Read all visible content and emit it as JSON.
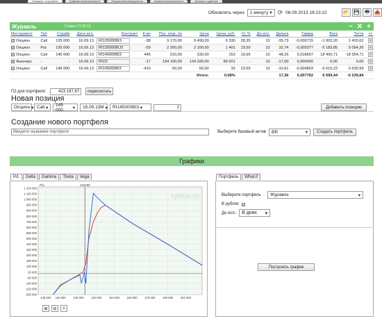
{
  "topnav": [
    "Позиции / портфели",
    "Графики волатильности",
    "Опционный калькулятор",
    "Анализ волатильности",
    "Экспорт и данные"
  ],
  "refresh": {
    "label": "Обновлять через",
    "interval": "1 минуту",
    "datetime": "06.09.2013 18:23:22"
  },
  "portfolio": {
    "title": "Журавль",
    "created": "Создан 21.09.13",
    "columns": [
      "Инструмент",
      "Тип",
      "Страйк",
      "Дата исп.",
      "Контракт",
      "К-во",
      "Поз. откр. по",
      "Цена",
      "Цена, руб.",
      "IV, %",
      "До исп.",
      "Дельта",
      "Гамма",
      "Вега",
      "Тетта",
      "+/-"
    ],
    "rows": [
      [
        "Опцион",
        "Call",
        "125 000",
        "16.09.13",
        "RI125000BI3",
        "-38",
        "9 170,00",
        "9 490,00",
        "6 330",
        "28,35",
        "10",
        "-35,73",
        "-0,000715",
        "-1 002,20",
        "1 420,62"
      ],
      [
        "Опцион",
        "Put",
        "135 000",
        "16.09.13",
        "RI135000BU3",
        "-59",
        "2 260,00",
        "2 100,00",
        "1 401",
        "19,50",
        "10",
        "32,74",
        "-0,005377",
        "-5 183,85",
        "5 054,26"
      ],
      [
        "Опцион",
        "Call",
        "140 000",
        "16.09.13",
        "RI140000BI3",
        "445",
        "210,00",
        "230,00",
        "153",
        "19,95",
        "10",
        "48,26",
        "0,018657",
        "18 400,71",
        "-18 354,71"
      ],
      [
        "Фьючерс",
        "-",
        "-",
        "16.09.13",
        "RIU3",
        "-17",
        "134 100,00",
        "134 330,00",
        "89 601",
        "-",
        "10",
        "-17,00",
        "0,000000",
        "0,00",
        "0,00"
      ],
      [
        "Опцион",
        "Call",
        "145 000",
        "16.09.13",
        "RI145000BI3",
        "-410",
        "50,00",
        "50,00",
        "33",
        "23,65",
        "10",
        "-10,91",
        "-0,004803",
        "-5 615,22",
        "6 639,99"
      ]
    ],
    "total_label": "Итого:",
    "total_pct": "0,08%",
    "totals": [
      "17,36",
      "0,007762",
      "6 599,44",
      "-5 239,84"
    ],
    "go_label": "ГО для портфеля:",
    "go_value": "423 187,67",
    "recalc": "пересчитать"
  },
  "new_position": {
    "title": "Новая позиция",
    "instrument": "Опцион",
    "type": "Call",
    "strike": "145 000",
    "date": "16.09.13М",
    "contract": "RI145000BI3",
    "qty": "1",
    "add_button": "Добавить позицию"
  },
  "new_portfolio": {
    "title": "Создание нового портфеля",
    "name_placeholder": "Введите название портфеля",
    "base_label": "Выберите базовый актив",
    "base_value": "BR",
    "create_button": "Создать портфель"
  },
  "graphs": {
    "title": "Графики",
    "tabs": [
      "P/L",
      "Delta",
      "Gamma",
      "Theta",
      "Vega"
    ],
    "watermark": "option.ru",
    "cursor_label": "134330",
    "right_tabs": [
      "Портфель",
      "What if"
    ],
    "select_label": "Выберите портфель",
    "select_value": "Журавль",
    "rub_label": "В рублях",
    "exp_label": "До исп.:",
    "exp_value": "В днях",
    "build_button": "Построить график"
  },
  "chart_data": {
    "type": "line",
    "title": "",
    "ylabel": "P/L",
    "xlim": [
      103000,
      213000
    ],
    "ylim": [
      -300000,
      1240000
    ],
    "x_ticks": [
      108000,
      118000,
      130000,
      142000,
      154000,
      166000,
      178000,
      190000,
      202000
    ],
    "y_ticks": [
      1220000,
      1140000,
      1060000,
      980000,
      900000,
      820000,
      740000,
      660000,
      580000,
      500000,
      420000,
      340000,
      260000,
      180000,
      100000,
      20000,
      -60000,
      -140000,
      -220000,
      -300000
    ],
    "series": [
      {
        "color": "#3a6ad8",
        "x": [
          113000,
          118000,
          127000,
          131000,
          132000,
          134000,
          135000,
          137000,
          140000,
          142000,
          148000,
          166000,
          190000,
          213000
        ],
        "y": [
          -300000,
          -160000,
          -60000,
          -20000,
          -140000,
          20000,
          -140000,
          600000,
          1150000,
          1100000,
          980000,
          720000,
          420000,
          120000
        ]
      },
      {
        "color": "#d04040",
        "x": [
          113000,
          118000,
          125000,
          130000,
          133000,
          135000,
          137000,
          140000,
          143000,
          145000,
          148000,
          166000,
          190000,
          213000
        ],
        "y": [
          -300000,
          -170000,
          -80000,
          -20000,
          20000,
          150000,
          500000,
          740000,
          880000,
          940000,
          980000,
          720000,
          420000,
          120000
        ]
      }
    ]
  }
}
